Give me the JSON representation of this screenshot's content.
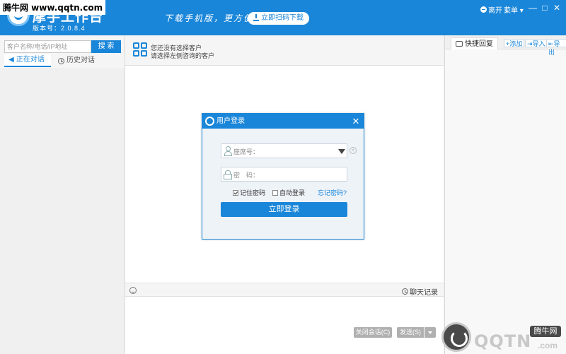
{
  "watermark_top": "腾牛网 www.qqtn.com",
  "titlebar": {
    "app_title": "摩手工作台",
    "version": "版本号：2.0.8.4",
    "slogan": "下载手机版，更方便!",
    "scan_label": "立即扫码下载",
    "status": "离开",
    "menu": "菜单",
    "min": "—",
    "max": "□",
    "close": "✕"
  },
  "left": {
    "search_placeholder": "客户名称/电话/IP地址",
    "search_btn": "搜 索",
    "tab_current": "正在对话",
    "tab_history": "历史对话"
  },
  "center": {
    "hint1": "您还没有选择客户",
    "hint2": "请选择左侧咨询的客户",
    "chat_history": "聊天记录",
    "close_conv": "关闭会话(C)",
    "send": "发送(S)"
  },
  "right": {
    "quick_reply": "快捷回复",
    "add": "+添加",
    "import": "导入",
    "export": "导出"
  },
  "dialog": {
    "title": "用户登录",
    "seat_placeholder": "座席号：",
    "password_placeholder": "密　码：",
    "remember": "记住密码",
    "auto_login": "自动登录",
    "forgot": "忘记密码?",
    "login": "立即登录",
    "remember_checked": true,
    "auto_checked": false
  },
  "watermark_bottom": {
    "text": "QQTN",
    "badge": "腾牛网",
    "com": ".com"
  },
  "colors": {
    "accent": "#1a86d9"
  }
}
